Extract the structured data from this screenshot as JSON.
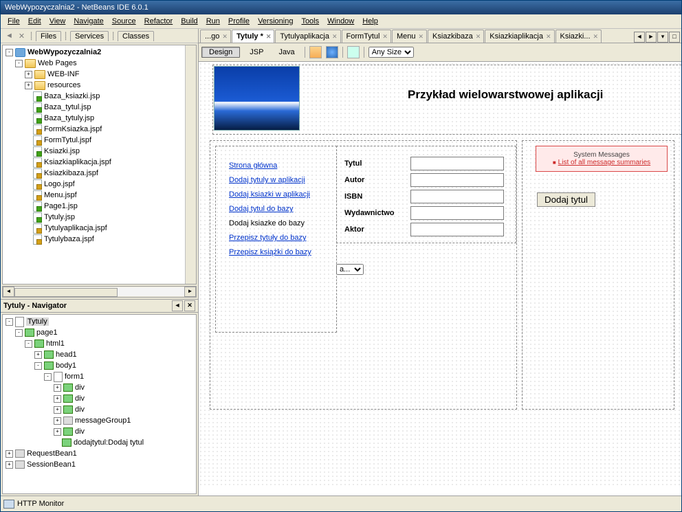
{
  "window": {
    "title": "WebWypozyczalnia2 - NetBeans IDE 6.0.1"
  },
  "menu": [
    "File",
    "Edit",
    "View",
    "Navigate",
    "Source",
    "Refactor",
    "Build",
    "Run",
    "Profile",
    "Versioning",
    "Tools",
    "Window",
    "Help"
  ],
  "left_tabs": [
    "Files",
    "Services",
    "Classes"
  ],
  "project": {
    "root": "WebWypozyczalnia2",
    "webpages": "Web Pages",
    "webinf": "WEB-INF",
    "resources": "resources",
    "files": [
      "Baza_ksiazki.jsp",
      "Baza_tytul.jsp",
      "Baza_tytuly.jsp",
      "FormKsiazka.jspf",
      "FormTytul.jspf",
      "Ksiazki.jsp",
      "Ksiazkiaplikacja.jspf",
      "Ksiazkibaza.jspf",
      "Logo.jspf",
      "Menu.jspf",
      "Page1.jsp",
      "Tytuly.jsp",
      "Tytulyaplikacja.jspf",
      "Tytulybaza.jspf"
    ],
    "filetype": [
      "jsp",
      "jsp",
      "jsp",
      "jspf",
      "jspf",
      "jsp",
      "jspf",
      "jspf",
      "jspf",
      "jspf",
      "jsp",
      "jsp",
      "jspf",
      "jspf"
    ]
  },
  "navigator": {
    "title": "Tytuly - Navigator",
    "items": [
      "Tytuly",
      "page1",
      "html1",
      "head1",
      "body1",
      "form1",
      "div",
      "div",
      "div",
      "messageGroup1",
      "div",
      "dodajtytul:Dodaj tytul"
    ],
    "beans": [
      "RequestBean1",
      "SessionBean1"
    ]
  },
  "status": "HTTP Monitor",
  "editor_tabs": [
    "...go",
    "Tytuly *",
    "Tytulyaplikacja",
    "FormTytul",
    "Menu",
    "Ksiazkibaza",
    "Ksiazkiaplikacja",
    "Ksiazki..."
  ],
  "editor_active": 1,
  "modes": {
    "design": "Design",
    "jsp": "JSP",
    "java": "Java",
    "size": "Any Size"
  },
  "page": {
    "heading": "Przykład wielowarstwowej aplikacji",
    "nav": [
      "Strona główna",
      "Dodaj tytuly w aplikacji",
      "Dodaj ksiazki w aplikacji",
      "Dodaj tytul do bazy",
      "Dodaj ksiazke do bazy",
      "Przepisz tytuły do bazy",
      "Przepisz książki do bazy"
    ],
    "nav_plain_idx": 4,
    "fields": [
      "Tytul",
      "Autor",
      "ISBN",
      "Wydawnictwo",
      "Aktor"
    ],
    "msg_title": "System Messages",
    "msg_sub": "List of all message summaries",
    "button": "Dodaj tytul",
    "combo": "a..."
  }
}
